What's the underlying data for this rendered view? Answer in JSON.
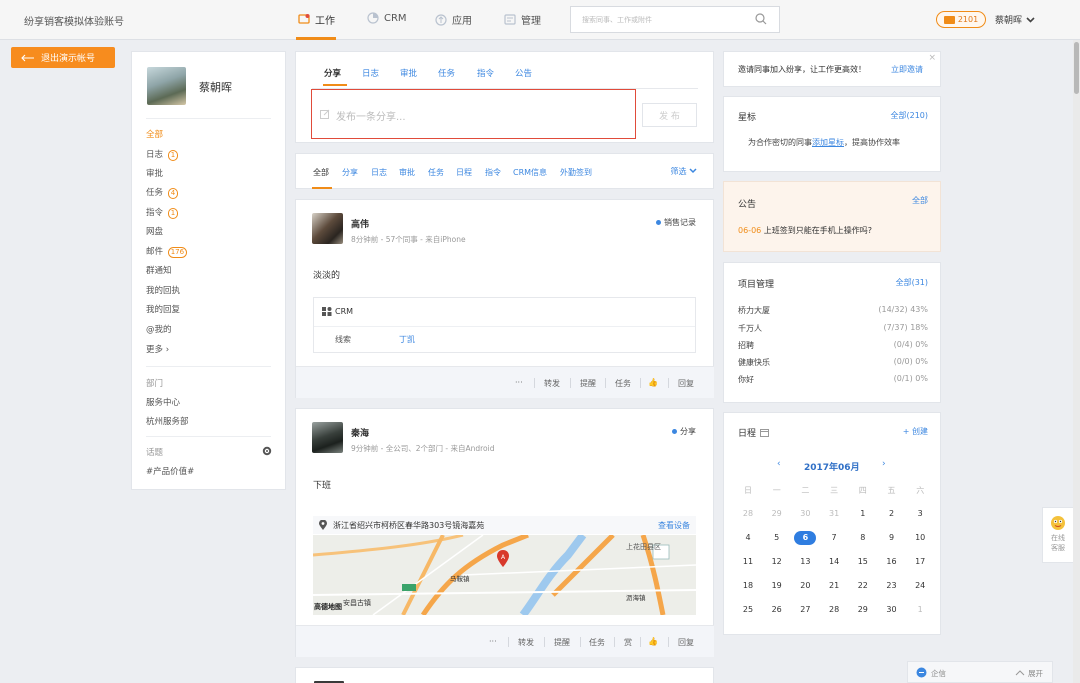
{
  "topbar": {
    "brand": "纷享销客模拟体验账号",
    "nav": [
      {
        "label": "工作",
        "icon": "work-icon",
        "active": true
      },
      {
        "label": "CRM",
        "icon": "crm-icon"
      },
      {
        "label": "应用",
        "icon": "apps-icon"
      },
      {
        "label": "管理",
        "icon": "manage-icon"
      }
    ],
    "search_placeholder": "搜索同事、工作或附件",
    "mail_count": "2101",
    "user_name": "蔡朝晖"
  },
  "exit_demo": "退出演示帐号",
  "profile": {
    "name": "蔡朝晖",
    "menu": [
      {
        "label": "全部",
        "active": true
      },
      {
        "label": "日志",
        "count": "1"
      },
      {
        "label": "审批"
      },
      {
        "label": "任务",
        "count": "4"
      },
      {
        "label": "指令",
        "count": "1"
      },
      {
        "label": "网盘"
      },
      {
        "label": "邮件",
        "count": "176"
      },
      {
        "label": "群通知"
      },
      {
        "label": "我的回执"
      },
      {
        "label": "我的回复"
      },
      {
        "label": "@我的"
      },
      {
        "label": "更多 ›"
      }
    ],
    "dept_title": "部门",
    "depts": [
      "服务中心",
      "杭州服务部"
    ],
    "topic_title": "话题",
    "topics": [
      "#产品价值#"
    ]
  },
  "publisher": {
    "tabs": [
      "分享",
      "日志",
      "审批",
      "任务",
      "指令",
      "公告"
    ],
    "placeholder": "发布一条分享...",
    "publish": "发 布"
  },
  "feed_filter": {
    "tabs": [
      "全部",
      "分享",
      "日志",
      "审批",
      "任务",
      "日程",
      "指令",
      "CRM信息",
      "外勤签到"
    ],
    "filter": "筛选"
  },
  "feeds": [
    {
      "name": "高伟",
      "meta": "8分钟前 - 57个同事 - 来自iPhone",
      "type": "销售记录",
      "text": "淡淡的",
      "crm_title": "CRM",
      "crm_key": "线索",
      "crm_value": "丁凯",
      "actions": [
        "···",
        "转发",
        "提醒",
        "任务",
        "👍",
        "回复"
      ]
    },
    {
      "name": "秦海",
      "meta": "9分钟前 - 全公司、2个部门 - 来自Android",
      "type": "分享",
      "text": "下班",
      "location": "浙江省绍兴市柯桥区春华路303号镜海嘉苑",
      "view_device": "查看设备",
      "map_labels": [
        "上花田县区",
        "马鞍镇",
        "沥海镇",
        "安昌古镇",
        "高德地图"
      ],
      "actions": [
        "···",
        "转发",
        "提醒",
        "任务",
        "赏",
        "👍",
        "回复"
      ]
    }
  ],
  "invite": {
    "text": "邀请同事加入纷享，让工作更高效！",
    "link": "立即邀请",
    "close": "×"
  },
  "star": {
    "title": "星标",
    "all": "全部(210)",
    "desc_pre": "为合作密切的同事",
    "desc_link": "添加星标",
    "desc_post": "，提高协作效率"
  },
  "notice": {
    "title": "公告",
    "all": "全部",
    "date": "06-06",
    "text": "上班签到只能在手机上操作吗?"
  },
  "projects": {
    "title": "项目管理",
    "all": "全部(31)",
    "rows": [
      {
        "name": "桥力大厦",
        "stat": "(14/32) 43%"
      },
      {
        "name": "千万人",
        "stat": "(7/37) 18%"
      },
      {
        "name": "招聘",
        "stat": "(0/4) 0%"
      },
      {
        "name": "健康快乐",
        "stat": "(0/0) 0%"
      },
      {
        "name": "你好",
        "stat": "(0/1) 0%"
      }
    ]
  },
  "calendar": {
    "title": "日程",
    "create": "+ 创建",
    "month": "2017年06月",
    "weekdays": [
      "日",
      "一",
      "二",
      "三",
      "四",
      "五",
      "六"
    ],
    "days": [
      "28",
      "29",
      "30",
      "31",
      "1",
      "2",
      "3",
      "4",
      "5",
      "6",
      "7",
      "8",
      "9",
      "10",
      "11",
      "12",
      "13",
      "14",
      "15",
      "16",
      "17",
      "18",
      "19",
      "20",
      "21",
      "22",
      "23",
      "24",
      "25",
      "26",
      "27",
      "28",
      "29",
      "30",
      "1"
    ],
    "muted": [
      0,
      1,
      2,
      3,
      34
    ],
    "today_index": 9
  },
  "online_service": [
    "在线",
    "客服"
  ],
  "qiye": {
    "label": "企信",
    "expand": "展开"
  }
}
